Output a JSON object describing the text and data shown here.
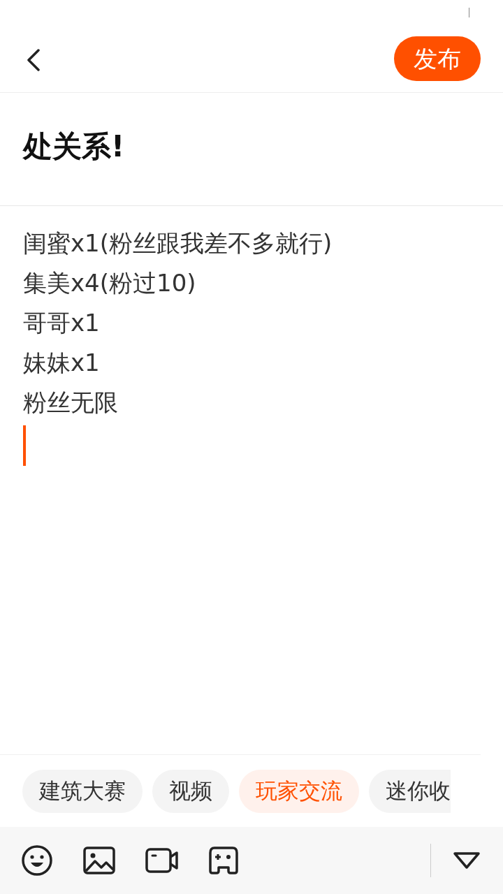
{
  "header": {
    "publish_button": "发布"
  },
  "title": "处关系!",
  "body_lines": [
    "闺蜜x1(粉丝跟我差不多就行)",
    "集美x4(粉过10)",
    "哥哥x1",
    "妹妹x1",
    "粉丝无限"
  ],
  "tags": [
    {
      "label": "建筑大赛",
      "selected": false
    },
    {
      "label": "视频",
      "selected": false
    },
    {
      "label": "玩家交流",
      "selected": true
    },
    {
      "label": "迷你收",
      "selected": false,
      "cut": true
    }
  ]
}
